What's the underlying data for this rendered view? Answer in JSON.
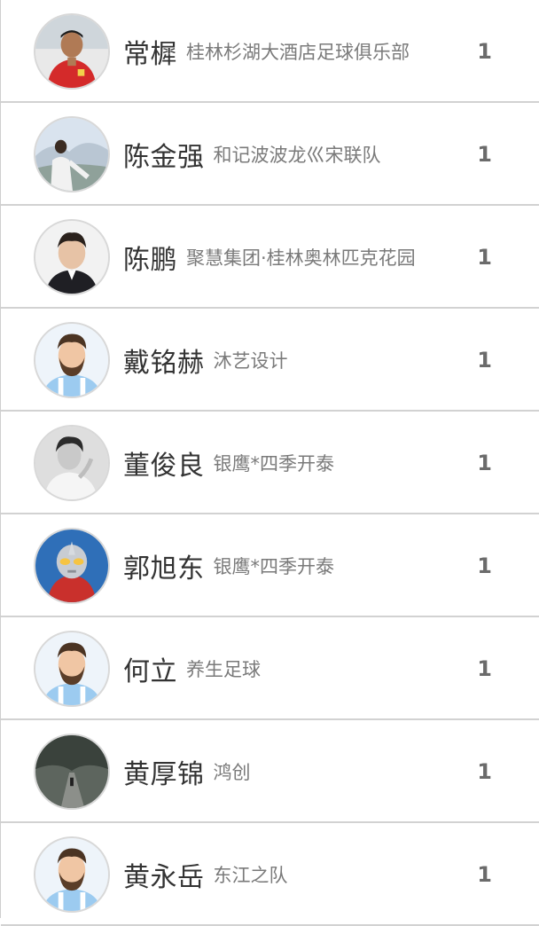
{
  "rows": [
    {
      "name": "常樨",
      "team": "桂林杉湖大酒店足球俱乐部",
      "count": "1",
      "avatar_icon": "red-jersey-man-avatar-icon"
    },
    {
      "name": "陈金强",
      "team": "和记波波龙巛宋联队",
      "count": "1",
      "avatar_icon": "scenery-man-avatar-icon"
    },
    {
      "name": "陈鹏",
      "team": "聚慧集团·桂林奥林匹克花园",
      "count": "1",
      "avatar_icon": "portrait-man-avatar-icon"
    },
    {
      "name": "戴铭赫",
      "team": "沐艺设计",
      "count": "1",
      "avatar_icon": "bearded-cartoon-avatar-icon"
    },
    {
      "name": "董俊良",
      "team": "银鹰*四季开泰",
      "count": "1",
      "avatar_icon": "monochrome-portrait-avatar-icon"
    },
    {
      "name": "郭旭东",
      "team": "银鹰*四季开泰",
      "count": "1",
      "avatar_icon": "ultraman-avatar-icon"
    },
    {
      "name": "何立",
      "team": "养生足球",
      "count": "1",
      "avatar_icon": "bearded-cartoon-avatar-icon"
    },
    {
      "name": "黄厚锦",
      "team": "鸿创",
      "count": "1",
      "avatar_icon": "road-scenery-avatar-icon"
    },
    {
      "name": "黄永岳",
      "team": "东江之队",
      "count": "1",
      "avatar_icon": "bearded-cartoon-avatar-icon"
    }
  ]
}
